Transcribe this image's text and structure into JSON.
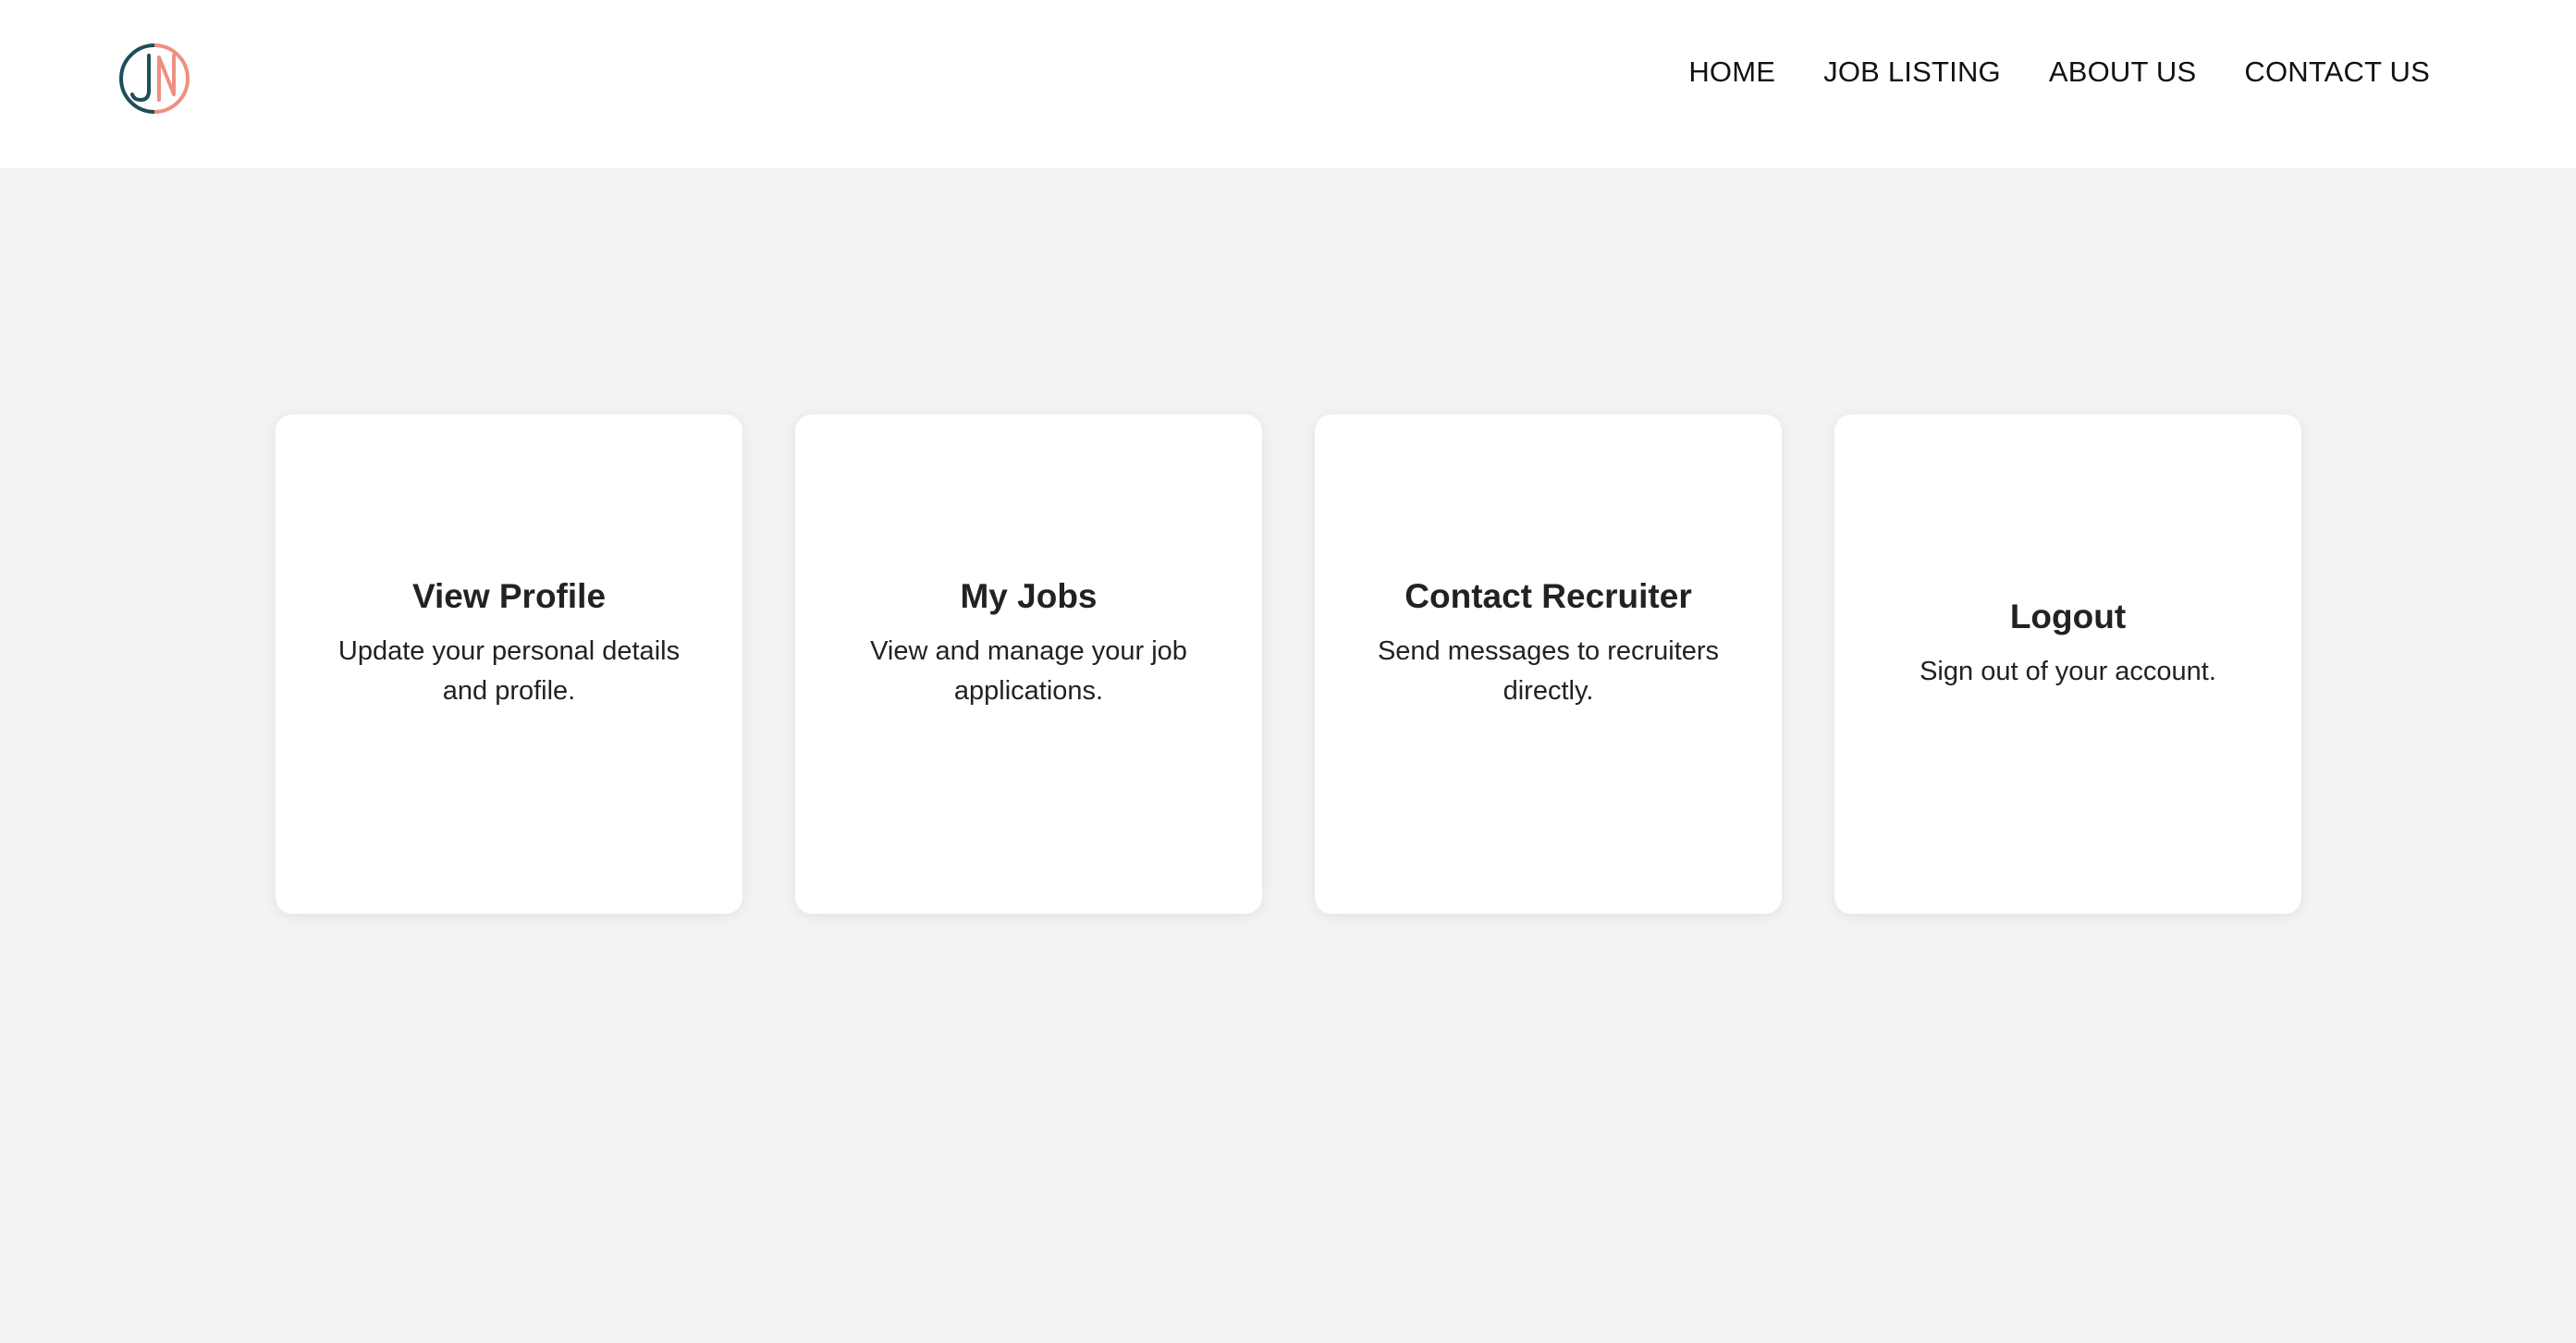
{
  "brand": {
    "logo_icon": "jn-monogram-logo",
    "colors": {
      "dark": "#1e4e5a",
      "accent": "#ef8f82"
    }
  },
  "nav": {
    "items": [
      {
        "label": "HOME"
      },
      {
        "label": "JOB LISTING"
      },
      {
        "label": "ABOUT US"
      },
      {
        "label": "CONTACT US"
      }
    ]
  },
  "cards": [
    {
      "title": "View Profile",
      "description": "Update your personal details and profile."
    },
    {
      "title": "My Jobs",
      "description": "View and manage your job applications."
    },
    {
      "title": "Contact Recruiter",
      "description": "Send messages to recruiters directly."
    },
    {
      "title": "Logout",
      "description": "Sign out of your account."
    }
  ],
  "colors": {
    "page_background": "#f3f3f3",
    "header_background": "#ffffff",
    "card_background": "#ffffff",
    "text": "#222222"
  }
}
